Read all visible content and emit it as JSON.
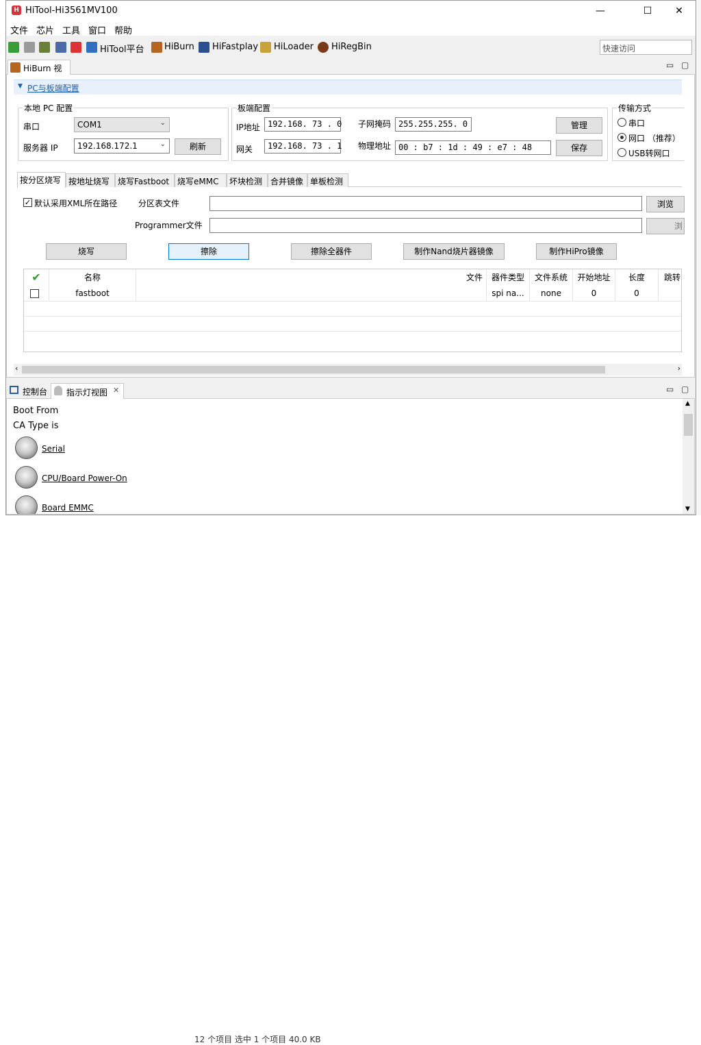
{
  "window": {
    "title": "HiTool-Hi3561MV100",
    "controls": {
      "minimize": "—",
      "maximize": "☐",
      "close": "✕"
    }
  },
  "menu": [
    "文件",
    "芯片",
    "工具",
    "窗口",
    "帮助"
  ],
  "toolbar": {
    "apps": [
      "HiTool平台",
      "HiBurn",
      "HiFastplay",
      "HiLoader",
      "HiRegBin"
    ],
    "quick_access_placeholder": "快速访问"
  },
  "hiburn_view": {
    "tab_label": "HiBurn 视图",
    "section_title": "PC与板端配置",
    "local_pc": {
      "title": "本地 PC 配置",
      "serial_label": "串口",
      "serial_value": "COM1",
      "server_ip_label": "服务器 IP",
      "server_ip_value": "192.168.172.1",
      "refresh_button": "刷新"
    },
    "board": {
      "title": "板端配置",
      "ip_label": "IP地址",
      "ip_value": "192.168. 73 . 0",
      "gateway_label": "网关",
      "gateway_value": "192.168. 73 . 1",
      "subnet_label": "子网掩码",
      "subnet_value": "255.255.255. 0",
      "mac_label": "物理地址",
      "mac_value": "00 : b7 : 1d : 49 : e7 : 48",
      "manage_button": "管理",
      "save_button": "保存"
    },
    "transfer": {
      "title": "传输方式",
      "options": [
        "串口",
        "网口 （推荐）",
        "USB转网口"
      ],
      "selected_index": 1
    },
    "burn_tabs": [
      "按分区烧写",
      "按地址烧写",
      "烧写Fastboot",
      "烧写eMMC",
      "坏块检测",
      "合并镜像",
      "单板检测"
    ],
    "active_burn_tab": 0,
    "partition": {
      "default_xml_checkbox": "默认采用XML所在路径",
      "default_xml_checked": true,
      "partition_file_label": "分区表文件",
      "partition_file_value": "",
      "browse_button": "浏览",
      "programmer_label": "Programmer文件",
      "programmer_value": "",
      "browse2_button": "浏"
    },
    "actions": [
      "烧写",
      "擦除",
      "擦除全器件",
      "制作Nand烧片器镜像",
      "制作HiPro镜像"
    ],
    "table": {
      "columns": [
        "✔",
        "名称",
        "文件",
        "器件类型",
        "文件系统",
        "开始地址",
        "长度",
        "跳转"
      ],
      "rows": [
        {
          "checked": false,
          "name": "fastboot",
          "file": "",
          "device": "spi na...",
          "fs": "none",
          "start": "0",
          "length": "0"
        }
      ]
    }
  },
  "bottom_panel": {
    "tabs": [
      "控制台",
      "指示灯视图"
    ],
    "lines": [
      "Boot From",
      "CA Type is"
    ],
    "leds": [
      "Serial",
      "CPU/Board Power-On",
      "Board EMMC"
    ]
  },
  "background_status": "12 个项目    选中 1 个项目  40.0 KB"
}
